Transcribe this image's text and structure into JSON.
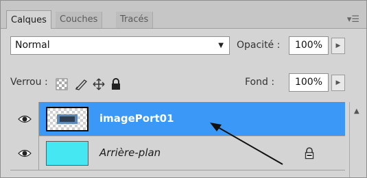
{
  "tabs": [
    {
      "label": "Calques",
      "active": true
    },
    {
      "label": "Couches",
      "active": false
    },
    {
      "label": "Tracés",
      "active": false
    }
  ],
  "panel_menu_icon": "panel-menu-icon",
  "blend_mode": {
    "value": "Normal"
  },
  "opacity": {
    "label": "Opacité :",
    "value": "100%"
  },
  "lock": {
    "label": "Verrou :",
    "icons": [
      "lock-transparency-icon",
      "lock-paint-icon",
      "lock-move-icon",
      "lock-all-icon"
    ]
  },
  "fill": {
    "label": "Fond :",
    "value": "100%"
  },
  "layers": [
    {
      "name": "imagePort01",
      "selected": true,
      "visible": true,
      "locked": false
    },
    {
      "name": "Arrière-plan",
      "selected": false,
      "visible": true,
      "locked": true
    }
  ],
  "colors": {
    "selection": "#3b98f7",
    "background_thumb": "#45e7f3",
    "panel": "#d4d4d4"
  }
}
